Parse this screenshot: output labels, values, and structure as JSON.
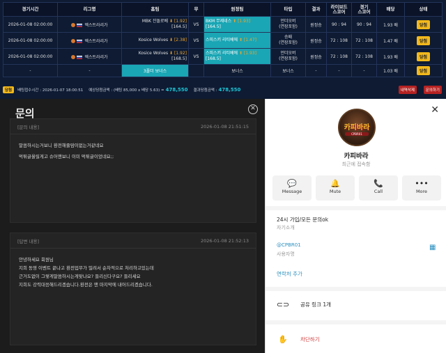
{
  "bet_table": {
    "headers": [
      "경기시간",
      "리그명",
      "홈팀",
      "무",
      "원정팀",
      "타입",
      "결과",
      "라이브드\n스코어",
      "경기\n스코어",
      "배당",
      "상태"
    ],
    "rows": [
      {
        "time": "2026-01-08 02:00:00",
        "league": "엑스트라리가",
        "home": "MBK 잔돌로베",
        "home_odds": "[1.92]",
        "home_line": "[164.5]",
        "draw": "VS",
        "away": "BKM 무제네스",
        "away_odds": "[1.93]",
        "away_line": "[164.5]",
        "type": "언더오버\n(연장포함)",
        "result": "원정승",
        "live": "90 : 94",
        "score": "90 : 94",
        "odds": "1.93 배",
        "status": "당첨",
        "selected": "away"
      },
      {
        "time": "2026-01-08 02:00:00",
        "league": "엑스트라리가",
        "home": "Kosice Wolves",
        "home_odds": "[2.38]",
        "home_line": "",
        "draw": "VS",
        "away": "스피스키 리티베에",
        "away_odds": "[1.47]",
        "away_line": "",
        "type": "승패\n(연장포함)",
        "result": "원정승",
        "live": "72 : 108",
        "score": "72 : 108",
        "odds": "1.47 배",
        "status": "당첨",
        "selected": "away"
      },
      {
        "time": "2026-01-08 02:00:00",
        "league": "엑스트라리가",
        "home": "Kosice Wolves",
        "home_odds": "[1.92]",
        "home_line": "[168.5]",
        "draw": "VS",
        "away": "스피스키 리티베에",
        "away_odds": "[1.93]",
        "away_line": "[168.5]",
        "type": "언더오버\n(연장포함)",
        "result": "원정승",
        "live": "72 : 108",
        "score": "72 : 108",
        "odds": "1.93 배",
        "status": "당첨",
        "selected": "away"
      }
    ],
    "bonus_row": {
      "time": "-",
      "league": "-",
      "home": "3폴더 보너스",
      "draw": "",
      "away": "보너스",
      "type": "보너스",
      "result": "-",
      "live": "-",
      "score": "-",
      "odds": "1.03 배",
      "status": "당첨"
    }
  },
  "summary": {
    "tag": "당첨",
    "bet_time": "배팅접수시간 : 2026-01-07 18:00:51",
    "expected_label": "예상당첨금액 : (배팅 85,000 x 배당 5.63) =",
    "expected_amount": "478,550",
    "result_label": "결과당첨금액 :",
    "result_amount": "478,550",
    "delete_button": "내역삭제",
    "inquiry_button": "문의하기"
  },
  "inquiry": {
    "title": "문의",
    "question_header": "[문의 내용]",
    "question_time": "2026-01-08 21:51:15",
    "question_lines": [
      "말씀하시는거보니 환전해줄맘이없는거같네요",
      "먹튀글올릴게고 슈어맨보니 이미 먹튀글이었네요;;"
    ],
    "answer_header": "[답변 내용]",
    "answer_time": "2026-01-08 21:52:13",
    "answer_lines": [
      "안녕하세요 회원님",
      "지희 동영 이벤트 끝나고 환전업무가 밀려서 순차적으로 처리하고있는데",
      "근거도없이 그렇게말씀하시는게맞나요? 들리신다구요? 들리세요",
      "지희도 강력대응해드리겠습니다.환전은 맨 마지막에 내어드리겠습니다."
    ]
  },
  "profile": {
    "logo_text": "카피바라",
    "logo_sub": "CPBR01",
    "name": "카피바라",
    "status": "최근에 접속함",
    "actions": [
      "Message",
      "Mute",
      "Call",
      "More"
    ],
    "intro": "24시 가입/모든 문의ok",
    "intro_sub": "자기소개",
    "handle": "@CPBR01",
    "handle_sub": "사용자명",
    "contact_add": "연락처 추가",
    "share_link": "공유 링크 1개",
    "block": "차단하기"
  }
}
